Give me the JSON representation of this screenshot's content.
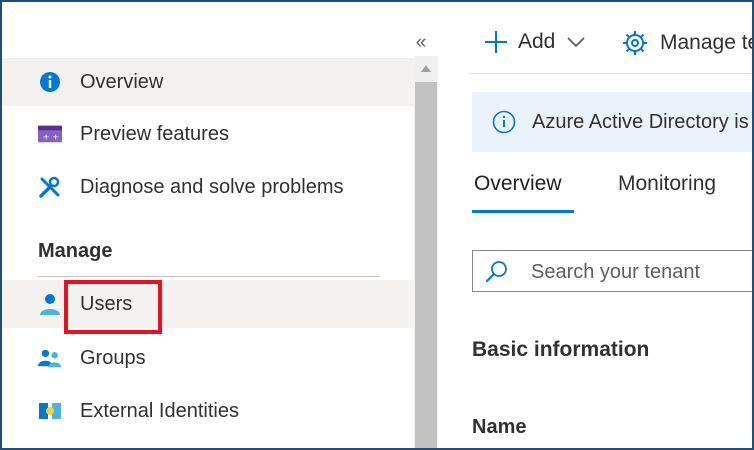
{
  "sidebar": {
    "collapse_glyph": "«",
    "items": [
      {
        "label": "Overview",
        "icon": "info-circle-icon"
      },
      {
        "label": "Preview features",
        "icon": "preview-features-icon"
      },
      {
        "label": "Diagnose and solve problems",
        "icon": "wrench-screwdriver-icon"
      },
      {
        "label": "Users",
        "icon": "user-icon"
      },
      {
        "label": "Groups",
        "icon": "groups-icon"
      },
      {
        "label": "External Identities",
        "icon": "external-identities-icon"
      }
    ],
    "section_header": "Manage"
  },
  "toolbar": {
    "add_label": "Add",
    "manage_label": "Manage te"
  },
  "banner": {
    "text": "Azure Active Directory is"
  },
  "tabs": [
    {
      "label": "Overview",
      "active": true
    },
    {
      "label": "Monitoring",
      "active": false
    }
  ],
  "search": {
    "placeholder": "Search your tenant"
  },
  "main": {
    "basic_info_heading": "Basic information",
    "name_label": "Name"
  },
  "colors": {
    "accent": "#0078d4",
    "highlight": "#e81123",
    "frame": "#1f4e79"
  }
}
